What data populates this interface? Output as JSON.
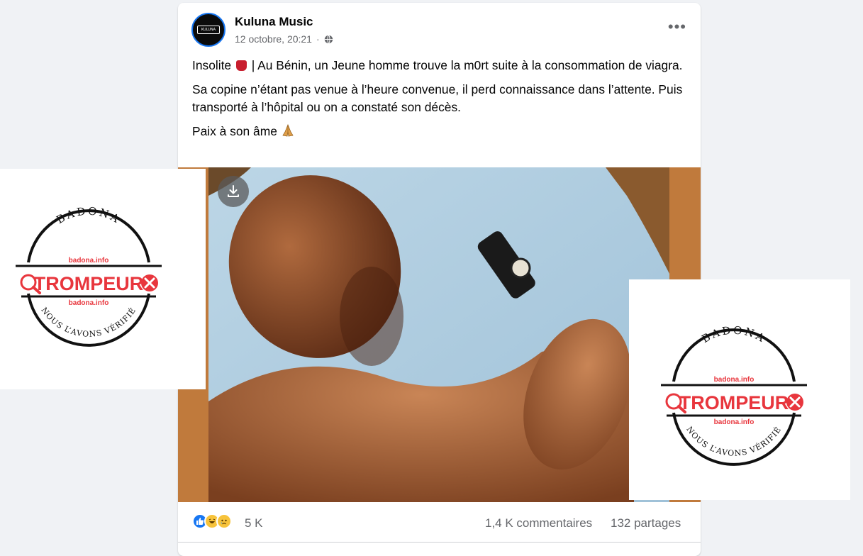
{
  "post": {
    "page_name": "Kuluna Music",
    "timestamp": "12 octobre, 20:21",
    "avatar_text": "KULUNA",
    "more_label": "•••",
    "text": {
      "p1_before": "Insolite",
      "p1_after": "| Au Bénin, un Jeune homme trouve la m0rt suite à la consommation de viagra.",
      "p2": "Sa copine n’étant pas venue à l’heure convenue, il perd connaissance dans l’attente. Puis transporté à l’hôpital ou on a constaté son décès.",
      "p3": "Paix à son âme"
    }
  },
  "engagement": {
    "reactions_count": "5 K",
    "comments": "1,4 K commentaires",
    "shares": "132 partages"
  },
  "stamp": {
    "top_text": "BADONA",
    "site_top": "badona.info",
    "verdict": "TROMPEUR",
    "site_bottom": "badona.info",
    "bottom_text": "NOUS L’AVONS VÉRIFIÉ"
  },
  "colors": {
    "accent": "#1877f2",
    "verdict_red": "#e8363d",
    "media_bg": "#c07a3c",
    "page_bg": "#f0f2f5"
  },
  "icons": [
    "globe-icon",
    "more-icon",
    "download-icon",
    "like-icon",
    "haha-icon",
    "sad-icon",
    "magnifier-icon",
    "close-circle-icon"
  ]
}
